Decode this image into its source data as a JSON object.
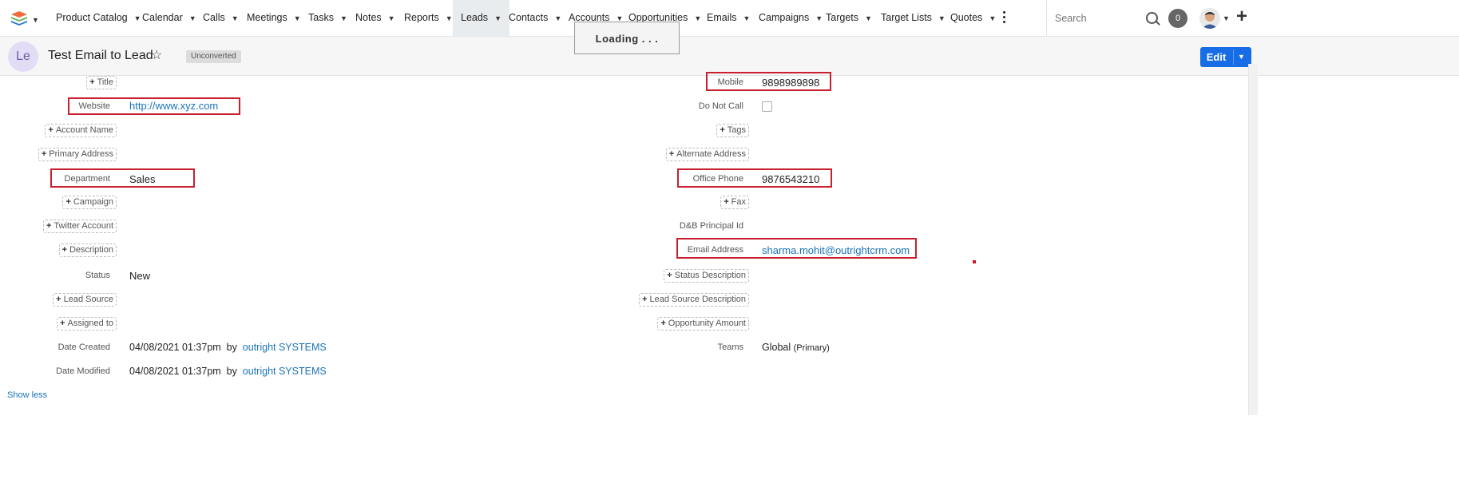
{
  "nav": {
    "items": [
      {
        "label": "Product Catalog"
      },
      {
        "label": "Calendar"
      },
      {
        "label": "Calls"
      },
      {
        "label": "Meetings"
      },
      {
        "label": "Tasks"
      },
      {
        "label": "Notes"
      },
      {
        "label": "Reports"
      },
      {
        "label": "Leads"
      },
      {
        "label": "Contacts"
      },
      {
        "label": "Accounts"
      },
      {
        "label": "Opportunities"
      },
      {
        "label": "Emails"
      },
      {
        "label": "Campaigns"
      },
      {
        "label": "Targets"
      },
      {
        "label": "Target Lists"
      },
      {
        "label": "Quotes"
      }
    ],
    "active": "Leads",
    "search_placeholder": "Search",
    "notification_count": "0"
  },
  "loading_text": "Loading . . .",
  "record": {
    "avatar_initials": "Le",
    "title": "Test Email to Lead",
    "status_badge": "Unconverted",
    "edit_label": "Edit"
  },
  "left_fields": {
    "title_btn": "Title",
    "website_label": "Website",
    "website_value": "http://www.xyz.com",
    "account_name_btn": "Account Name",
    "primary_address_btn": "Primary Address",
    "department_label": "Department",
    "department_value": "Sales",
    "campaign_btn": "Campaign",
    "twitter_btn": "Twitter Account",
    "description_btn": "Description",
    "status_label": "Status",
    "status_value": "New",
    "lead_source_btn": "Lead Source",
    "assigned_to_btn": "Assigned to",
    "date_created_label": "Date Created",
    "date_created_value": "04/08/2021 01:37pm",
    "date_created_by": "by",
    "date_created_user": "outright SYSTEMS",
    "date_modified_label": "Date Modified",
    "date_modified_value": "04/08/2021 01:37pm",
    "date_modified_by": "by",
    "date_modified_user": "outright SYSTEMS"
  },
  "right_fields": {
    "mobile_label": "Mobile",
    "mobile_value": "9898989898",
    "do_not_call_label": "Do Not Call",
    "tags_btn": "Tags",
    "alternate_address_btn": "Alternate Address",
    "office_phone_label": "Office Phone",
    "office_phone_value": "9876543210",
    "fax_btn": "Fax",
    "dnb_label": "D&B Principal Id",
    "email_label": "Email Address",
    "email_value": "sharma.mohit@outrightcrm.com",
    "status_desc_btn": "Status Description",
    "lead_source_desc_btn": "Lead Source Description",
    "opportunity_amount_btn": "Opportunity Amount",
    "teams_label": "Teams",
    "teams_value": "Global",
    "teams_primary": "(Primary)"
  },
  "show_less": "Show less",
  "colors": {
    "accent": "#176de5",
    "highlight_box": "#c8202f",
    "link": "#1a73b8"
  }
}
